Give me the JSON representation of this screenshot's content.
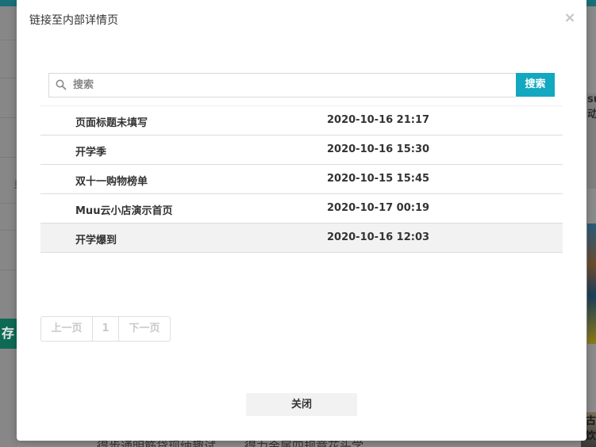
{
  "modal": {
    "title": "链接至内部详情页",
    "close_symbol": "×"
  },
  "search": {
    "placeholder": "搜索",
    "button_label": "搜索",
    "button_color": "#11a8c0"
  },
  "pages": [
    {
      "title": "页面标题未填写",
      "time": "2020-10-16 21:17"
    },
    {
      "title": "开学季",
      "time": "2020-10-16 15:30"
    },
    {
      "title": "双十一购物榜单",
      "time": "2020-10-15 15:45"
    },
    {
      "title": "Muu云小店演示首页",
      "time": "2020-10-17 00:19"
    },
    {
      "title": "开学爆到",
      "time": "2020-10-16 12:03"
    }
  ],
  "pagination": {
    "prev_label": "上一页",
    "current": "1",
    "next_label": "下一页"
  },
  "footer": {
    "close_label": "关闭"
  },
  "background": {
    "left_green_text": "存",
    "left_char": "封",
    "right_strip_text": "su\n动",
    "right_bottom_text": "古\n饮",
    "bottom_text_1": "得步通明筋贷现纳趣试",
    "bottom_text_2": "得力金属四规章花头学"
  }
}
